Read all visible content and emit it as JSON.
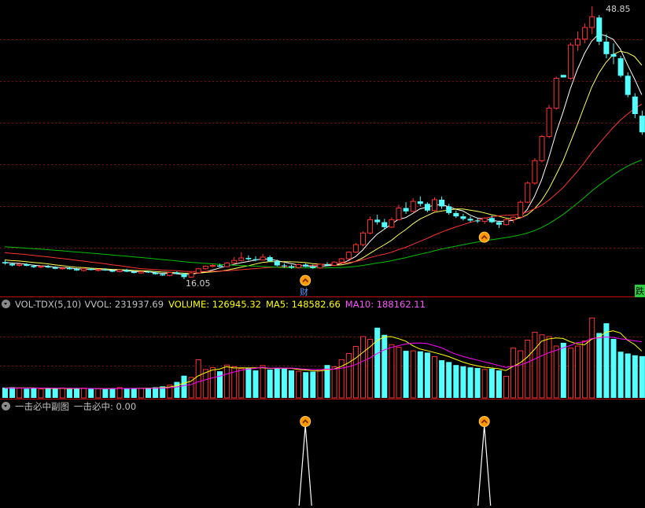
{
  "chart_data": {
    "type": "candlestick",
    "price_panel": {
      "ohlc": [
        [
          18.1,
          18.3,
          17.8,
          17.95
        ],
        [
          17.9,
          18.05,
          17.6,
          17.7
        ],
        [
          17.7,
          17.9,
          17.55,
          17.85
        ],
        [
          17.85,
          17.95,
          17.6,
          17.65
        ],
        [
          17.65,
          17.8,
          17.4,
          17.5
        ],
        [
          17.5,
          17.7,
          17.35,
          17.6
        ],
        [
          17.6,
          17.75,
          17.4,
          17.45
        ],
        [
          17.45,
          17.6,
          17.25,
          17.3
        ],
        [
          17.3,
          17.5,
          17.2,
          17.4
        ],
        [
          17.4,
          17.55,
          17.2,
          17.25
        ],
        [
          17.25,
          17.4,
          17.05,
          17.1
        ],
        [
          17.1,
          17.35,
          17.0,
          17.3
        ],
        [
          17.3,
          17.4,
          17.1,
          17.15
        ],
        [
          17.15,
          17.3,
          17.0,
          17.2
        ],
        [
          17.2,
          17.35,
          17.05,
          17.1
        ],
        [
          17.1,
          17.25,
          16.9,
          16.95
        ],
        [
          16.95,
          17.2,
          16.85,
          17.15
        ],
        [
          17.15,
          17.3,
          16.9,
          16.95
        ],
        [
          16.95,
          17.1,
          16.75,
          16.8
        ],
        [
          16.8,
          17.0,
          16.7,
          16.95
        ],
        [
          16.95,
          17.1,
          16.8,
          16.85
        ],
        [
          16.85,
          17.0,
          16.6,
          16.65
        ],
        [
          16.65,
          16.8,
          16.45,
          16.5
        ],
        [
          16.5,
          16.9,
          16.4,
          16.85
        ],
        [
          16.85,
          17.0,
          16.6,
          16.7
        ],
        [
          16.7,
          16.8,
          16.05,
          16.3
        ],
        [
          16.3,
          16.9,
          16.2,
          16.8
        ],
        [
          16.8,
          17.4,
          16.7,
          17.3
        ],
        [
          17.3,
          17.7,
          17.2,
          17.6
        ],
        [
          17.6,
          17.9,
          17.5,
          17.7
        ],
        [
          17.7,
          17.9,
          17.5,
          17.55
        ],
        [
          17.55,
          18.1,
          17.5,
          18.0
        ],
        [
          18.0,
          18.7,
          17.9,
          18.3
        ],
        [
          18.3,
          19.3,
          18.2,
          18.6
        ],
        [
          18.6,
          18.9,
          18.3,
          18.45
        ],
        [
          18.45,
          18.8,
          18.2,
          18.35
        ],
        [
          18.35,
          19.1,
          18.3,
          18.7
        ],
        [
          18.7,
          18.9,
          18.1,
          18.2
        ],
        [
          18.2,
          18.4,
          17.6,
          17.7
        ],
        [
          17.7,
          17.95,
          17.4,
          17.6
        ],
        [
          17.6,
          17.8,
          17.3,
          17.45
        ],
        [
          17.45,
          17.9,
          17.3,
          17.8
        ],
        [
          17.8,
          17.95,
          17.5,
          17.55
        ],
        [
          17.55,
          17.8,
          17.3,
          17.4
        ],
        [
          17.4,
          17.9,
          17.3,
          17.85
        ],
        [
          17.85,
          18.1,
          17.6,
          17.7
        ],
        [
          17.7,
          18.2,
          17.6,
          18.1
        ],
        [
          18.1,
          18.6,
          18.0,
          18.5
        ],
        [
          18.5,
          19.4,
          18.4,
          19.3
        ],
        [
          19.3,
          20.4,
          19.2,
          20.2
        ],
        [
          20.2,
          21.8,
          20.0,
          21.6
        ],
        [
          21.6,
          23.6,
          21.4,
          23.2
        ],
        [
          23.2,
          23.8,
          22.6,
          22.9
        ],
        [
          22.9,
          23.3,
          22.0,
          22.3
        ],
        [
          22.3,
          23.5,
          22.2,
          23.2
        ],
        [
          23.2,
          25.0,
          23.1,
          24.6
        ],
        [
          24.6,
          25.3,
          23.9,
          24.2
        ],
        [
          24.2,
          25.8,
          24.1,
          25.4
        ],
        [
          25.4,
          26.0,
          24.8,
          25.1
        ],
        [
          25.1,
          25.3,
          24.1,
          24.3
        ],
        [
          24.3,
          25.9,
          24.2,
          25.6
        ],
        [
          25.6,
          26.0,
          24.5,
          24.8
        ],
        [
          24.8,
          25.1,
          23.8,
          24.0
        ],
        [
          24.0,
          24.3,
          23.4,
          23.6
        ],
        [
          23.6,
          23.9,
          23.1,
          23.3
        ],
        [
          23.3,
          23.6,
          22.9,
          23.1
        ],
        [
          23.1,
          23.4,
          22.8,
          23.0
        ],
        [
          23.0,
          23.5,
          22.7,
          23.4
        ],
        [
          23.4,
          23.7,
          22.8,
          22.9
        ],
        [
          22.9,
          23.1,
          22.2,
          22.6
        ],
        [
          22.6,
          23.3,
          22.5,
          23.2
        ],
        [
          23.2,
          23.6,
          22.8,
          23.5
        ],
        [
          23.5,
          25.5,
          23.4,
          25.3
        ],
        [
          25.3,
          27.8,
          25.2,
          27.6
        ],
        [
          27.6,
          30.6,
          27.4,
          30.3
        ],
        [
          30.3,
          33.4,
          30.1,
          33.2
        ],
        [
          33.2,
          37.0,
          33.0,
          36.6
        ],
        [
          36.6,
          40.4,
          36.4,
          40.2
        ],
        [
          40.6,
          40.6,
          40.3,
          40.3
        ],
        [
          40.2,
          44.5,
          40.0,
          44.2
        ],
        [
          44.2,
          45.8,
          43.5,
          44.9
        ],
        [
          44.9,
          46.8,
          44.4,
          46.3
        ],
        [
          46.3,
          48.85,
          45.5,
          47.6
        ],
        [
          47.5,
          47.8,
          44.2,
          44.6
        ],
        [
          44.6,
          45.5,
          42.6,
          43.1
        ],
        [
          43.1,
          44.4,
          41.9,
          42.8
        ],
        [
          42.6,
          42.9,
          40.3,
          40.5
        ],
        [
          40.5,
          40.9,
          37.9,
          38.2
        ],
        [
          38.0,
          38.4,
          35.4,
          35.9
        ],
        [
          35.7,
          36.3,
          33.4,
          33.7
        ]
      ],
      "min_label": "16.05",
      "max_label": "48.85",
      "finance_tag": "财",
      "side_tag": "跌"
    },
    "volume_panel": {
      "title": "VOL-TDX(5,10)",
      "vvol_label": "VVOL: 231937.69",
      "volume_label": "VOLUME: 126945.32",
      "ma5_label": "MA5: 148582.66",
      "ma10_label": "MA10: 188162.11",
      "volumes": [
        58000,
        60000,
        55000,
        52000,
        57000,
        50000,
        54000,
        52000,
        56000,
        50000,
        53000,
        55000,
        51000,
        53000,
        50000,
        54000,
        58000,
        51000,
        55000,
        53000,
        57000,
        60000,
        65000,
        72000,
        90000,
        125000,
        115000,
        215000,
        160000,
        170000,
        150000,
        185000,
        175000,
        165000,
        168000,
        155000,
        182000,
        160000,
        170000,
        165000,
        155000,
        150000,
        145000,
        148000,
        160000,
        185000,
        175000,
        215000,
        250000,
        290000,
        345000,
        330000,
        395000,
        355000,
        300000,
        285000,
        265000,
        265000,
        262000,
        255000,
        232000,
        212000,
        202000,
        185000,
        178000,
        172000,
        168000,
        160000,
        165000,
        155000,
        122000,
        280000,
        265000,
        325000,
        370000,
        355000,
        345000,
        292000,
        310000,
        280000,
        292000,
        320000,
        450000,
        365000,
        420000,
        332000,
        260000,
        250000,
        240000,
        235000
      ],
      "vmax": 500000
    },
    "signal_panel": {
      "title": "一击必中副图",
      "value_label": "一击必中: 0.00",
      "signal_indices": [
        42,
        67
      ]
    },
    "colors": {
      "bg": "#000000",
      "up": "#ff3232",
      "down": "#54ffff",
      "ma5": "#ffffff",
      "ma10": "#ffff54",
      "ma20": "#ff3232",
      "ma60": "#00c000",
      "ma120": "#ff3232",
      "grid": "#7a1010",
      "vol_ma5": "#ffff00",
      "vol_ma10": "#ff00ff",
      "vvol_text": "#c0c0c0",
      "volume_text": "#ffff00",
      "ma5_text": "#ffff00",
      "ma10_text": "#ff54ff",
      "signal": "#ffffff",
      "marker": "#ff9900"
    }
  }
}
